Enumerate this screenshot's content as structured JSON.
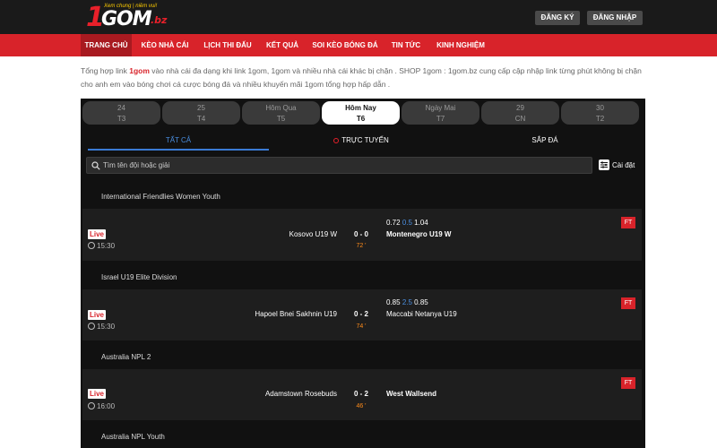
{
  "header": {
    "logo": {
      "one": "1",
      "gom": "GOM",
      "bz": ".bz",
      "tagline": "Xem chung | niềm vui!"
    },
    "register_label": "ĐĂNG KÝ",
    "login_label": "ĐĂNG NHẬP"
  },
  "nav": {
    "items": [
      {
        "label": "TRANG CHỦ",
        "active": true
      },
      {
        "label": "KÈO NHÀ CÁI"
      },
      {
        "label": "LỊCH THI ĐẤU"
      },
      {
        "label": "KẾT QUẢ"
      },
      {
        "label": "SOI KÈO BÓNG ĐÁ"
      },
      {
        "label": "TIN TỨC"
      },
      {
        "label": "KINH NGHIỆM"
      }
    ]
  },
  "intro": {
    "part1": "Tổng hợp link ",
    "brand": "1gom",
    "part2": " vào nhà cái đa dạng khi link 1gom, 1gom và nhiều nhà cái khác bị chặn . SHOP 1gom : 1gom.bz cung cấp cập nhập link từng phút không bị chặn cho anh em vào bóng chơi cá cược bóng đá và nhiều khuyến mãi 1gom tổng hợp hấp dẫn ."
  },
  "days": [
    {
      "top": "24",
      "bottom": "T3"
    },
    {
      "top": "25",
      "bottom": "T4"
    },
    {
      "top": "Hôm Qua",
      "bottom": "T5"
    },
    {
      "top": "Hôm Nay",
      "bottom": "T6",
      "active": true
    },
    {
      "top": "Ngày Mai",
      "bottom": "T7"
    },
    {
      "top": "29",
      "bottom": "CN"
    },
    {
      "top": "30",
      "bottom": "T2"
    }
  ],
  "tabs": {
    "all": "TẤT CẢ",
    "live": "TRỰC TUYẾN",
    "upcoming": "SẮP ĐÁ"
  },
  "search": {
    "placeholder": "Tìm tên đội hoặc giải"
  },
  "settings_label": "Cài đặt",
  "leagues": [
    {
      "name": "International Friendlies Women Youth",
      "match": {
        "status": "Live",
        "time": "15:30",
        "home": "Kosovo U19 W",
        "score": "0 - 0",
        "minute": "72 '",
        "away": "Montenegro U19 W",
        "away_bold": true,
        "odds": {
          "o1": "0.72",
          "line": "0.5",
          "o2": "1.04"
        },
        "badge": "FT"
      }
    },
    {
      "name": "Israel U19 Elite Division",
      "match": {
        "status": "Live",
        "time": "15:30",
        "home": "Hapoel Bnei Sakhnin U19",
        "score": "0 - 2",
        "minute": "74 '",
        "away": "Maccabi Netanya U19",
        "away_bold": false,
        "odds": {
          "o1": "0.85",
          "line": "2.5",
          "o2": "0.85"
        },
        "badge": "FT"
      }
    },
    {
      "name": "Australia NPL 2",
      "match": {
        "status": "Live",
        "time": "16:00",
        "home": "Adamstown Rosebuds",
        "score": "0 - 2",
        "minute": "46 '",
        "away": "West Wallsend",
        "away_bold": true,
        "odds": null,
        "badge": "FT"
      }
    },
    {
      "name": "Australia NPL Youth"
    }
  ],
  "colors": {
    "brand_red": "#d8232a",
    "live_blue": "#3a7bd5",
    "minute_orange": "#ff8c1a"
  }
}
